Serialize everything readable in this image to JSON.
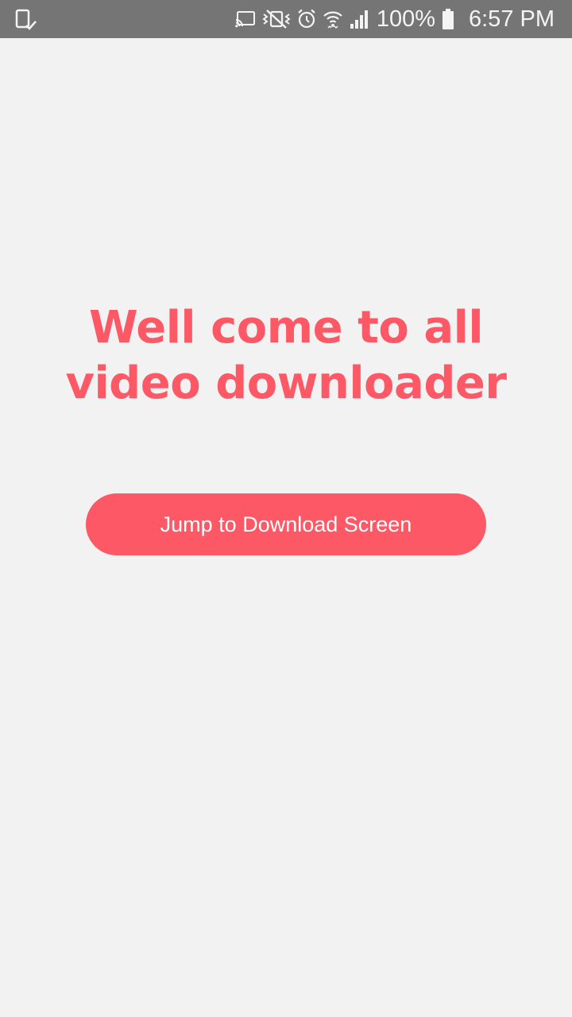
{
  "status_bar": {
    "left_icon": "device-check-icon",
    "icons": [
      "cast-icon",
      "vibrate-mute-icon",
      "alarm-icon",
      "wifi-icon",
      "signal-icon",
      "battery-icon"
    ],
    "battery_percent": "100%",
    "time": "6:57 PM"
  },
  "main": {
    "title": "Well come to all video downloader",
    "button_label": "Jump to Download Screen"
  },
  "colors": {
    "accent": "#fd5866",
    "background": "#f2f2f2",
    "status_bar": "#757575"
  }
}
